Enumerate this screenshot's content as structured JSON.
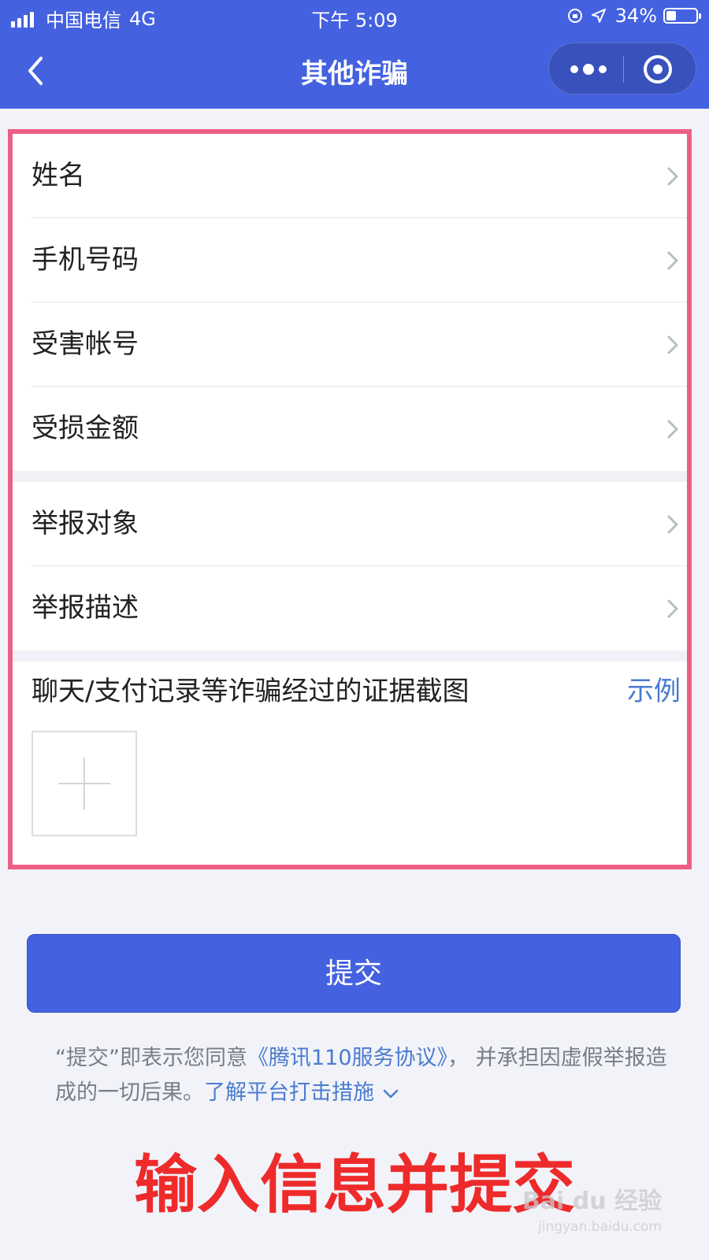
{
  "status_bar": {
    "carrier": "中国电信",
    "network": "4G",
    "time": "下午 5:09",
    "battery": "34%",
    "battery_level": 0.34
  },
  "nav": {
    "title": "其他诈骗",
    "back_icon": "chevron-left-icon",
    "more_icon": "more-dots-icon",
    "close_icon": "target-close-icon"
  },
  "form": {
    "group1": [
      {
        "label": "姓名"
      },
      {
        "label": "手机号码"
      },
      {
        "label": "受害帐号"
      },
      {
        "label": "受损金额"
      }
    ],
    "group2": [
      {
        "label": "举报对象"
      },
      {
        "label": "举报描述"
      }
    ],
    "evidence": {
      "title": "聊天/支付记录等诈骗经过的证据截图",
      "example_link": "示例",
      "add_icon": "plus-icon"
    }
  },
  "submit": {
    "label": "提交"
  },
  "agreement": {
    "prefix": "“提交”即表示您同意",
    "link": "《腾讯110服务协议》",
    "suffix": "， 并承担因虚假举报造成的一切后果。",
    "more_link": "了解平台打击措施"
  },
  "annotation": {
    "caption": "输入信息并提交"
  },
  "watermark": {
    "brand": "Bai du 经验",
    "url": "jingyan.baidu.com"
  },
  "colors": {
    "brand_blue": "#4461e0",
    "highlight_border": "#ee5f86",
    "link_blue": "#4a7bd0",
    "caption_red": "#ee2a2a"
  }
}
